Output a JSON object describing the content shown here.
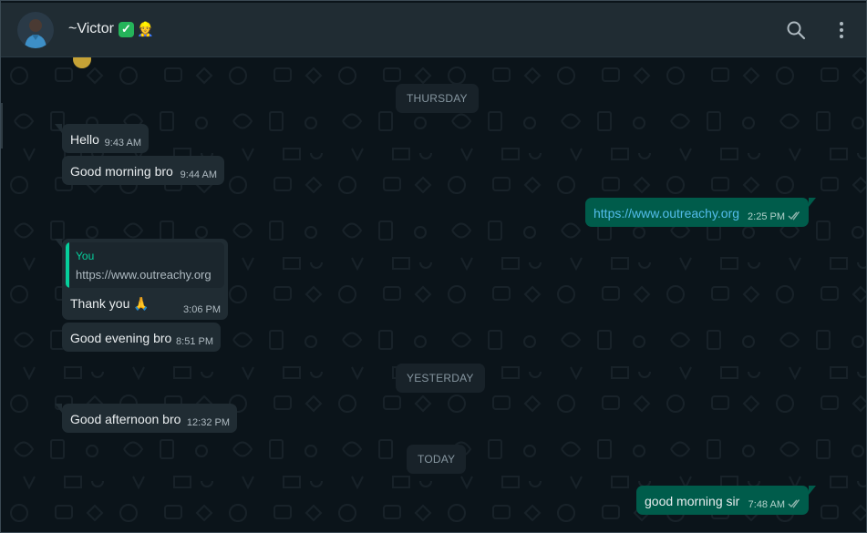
{
  "header": {
    "contact_name": "~Victor",
    "verified_badge": "✓",
    "name_emoji": "👷",
    "icons": [
      "search-icon",
      "more-options-icon"
    ]
  },
  "colors": {
    "chat_background": "#0b141a",
    "header": "#202c33",
    "incoming_bubble": "#202c33",
    "outgoing_bubble": "#005c4b",
    "read_ticks": "#53bdeb"
  },
  "date_separators": {
    "thursday": "THURSDAY",
    "yesterday": "YESTERDAY",
    "today": "TODAY"
  },
  "messages": [
    {
      "direction": "in",
      "text": "Hello",
      "time": "9:43 AM"
    },
    {
      "direction": "in",
      "text": "Good morning bro",
      "time": "9:44 AM"
    },
    {
      "direction": "out",
      "text": "https://www.outreachy.org",
      "time": "2:25 PM",
      "status": "read"
    },
    {
      "direction": "in",
      "reply_to_author": "You",
      "reply_to_text": "https://www.outreachy.org",
      "text": "Thank you 🙏",
      "time": "3:06 PM"
    },
    {
      "direction": "in",
      "text": "Good evening bro",
      "time": "8:51 PM"
    },
    {
      "direction": "in",
      "text": "Good afternoon bro",
      "time": "12:32 PM"
    },
    {
      "direction": "out",
      "text": "good morning sir",
      "time": "7:48 AM",
      "status": "read"
    }
  ]
}
